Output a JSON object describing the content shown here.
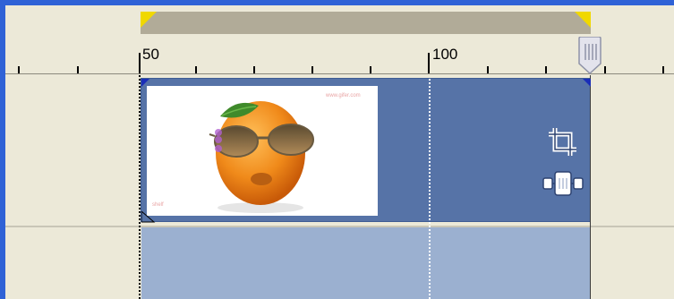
{
  "timeline": {
    "ruler": {
      "label_50": "50",
      "label_100": "100"
    },
    "clip": {
      "watermark_top": "www.gifer.com",
      "watermark_bottom": "shelf"
    }
  },
  "colors": {
    "clip_bg": "#5673a7",
    "clip_lower_bg": "#9bb0d0",
    "range_bar": "#b1ab98",
    "range_marker": "#f0d800",
    "window_frame": "#2f62d6"
  },
  "icons": {
    "crop": "crop-icon",
    "resize": "resize-handle-icon",
    "playhead": "playhead-handle-icon"
  }
}
